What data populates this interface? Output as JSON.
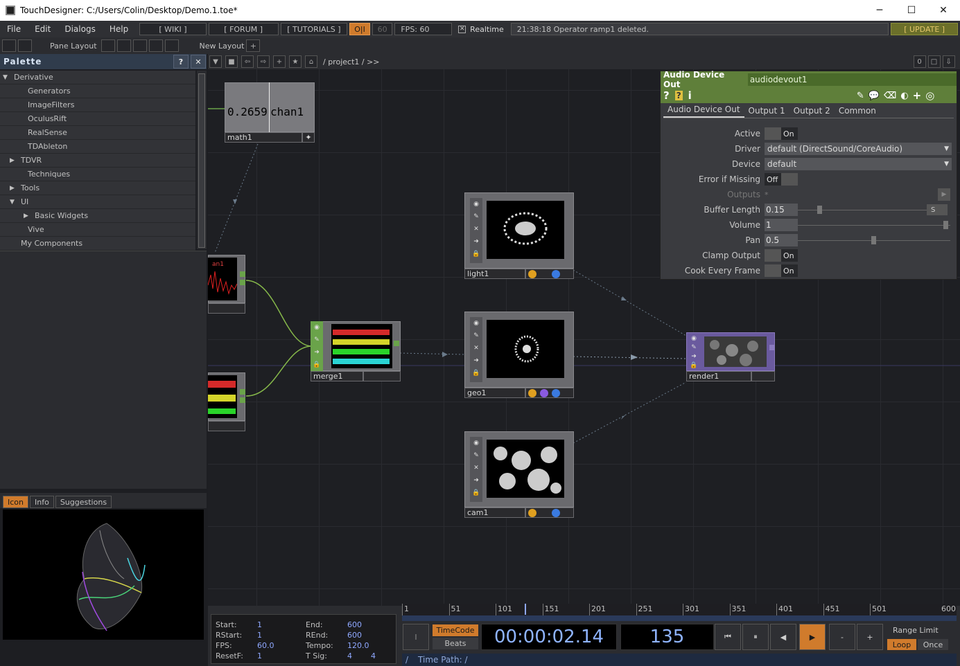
{
  "titlebar": {
    "title": "TouchDesigner: C:/Users/Colin/Desktop/Demo.1.toe*"
  },
  "menubar": {
    "menus": [
      "File",
      "Edit",
      "Dialogs",
      "Help"
    ],
    "buttons": {
      "wiki": "[ WIKI ]",
      "forum": "[ FORUM ]",
      "tutorials": "[ TUTORIALS ]",
      "oi": "O|I",
      "fps_cap": "60",
      "fps": "FPS:  60",
      "realtime": "Realtime"
    },
    "status": "21:38:18 Operator ramp1 deleted.",
    "update": "[ UPDATE ]"
  },
  "toolbar2": {
    "pane_layout": "Pane Layout",
    "new_layout": "New Layout",
    "plus": "+"
  },
  "palette": {
    "title": "Palette",
    "help": "?",
    "close": "✕",
    "items": [
      {
        "label": "Derivative",
        "indent": 0,
        "arrow": "▼"
      },
      {
        "label": "Generators",
        "indent": 2,
        "arrow": ""
      },
      {
        "label": "ImageFilters",
        "indent": 2,
        "arrow": ""
      },
      {
        "label": "OculusRift",
        "indent": 2,
        "arrow": ""
      },
      {
        "label": "RealSense",
        "indent": 2,
        "arrow": ""
      },
      {
        "label": "TDAbleton",
        "indent": 2,
        "arrow": ""
      },
      {
        "label": "TDVR",
        "indent": 1,
        "arrow": "▶"
      },
      {
        "label": "Techniques",
        "indent": 2,
        "arrow": ""
      },
      {
        "label": "Tools",
        "indent": 1,
        "arrow": "▶"
      },
      {
        "label": "UI",
        "indent": 1,
        "arrow": "▼"
      },
      {
        "label": "Basic Widgets",
        "indent": 3,
        "arrow": "▶"
      },
      {
        "label": "Vive",
        "indent": 2,
        "arrow": ""
      },
      {
        "label": "My Components",
        "indent": 1,
        "arrow": ""
      }
    ],
    "tabs": [
      "Icon",
      "Info",
      "Suggestions"
    ]
  },
  "network": {
    "path": "/ project1 / >>",
    "zero": "0",
    "nodes": {
      "math1": {
        "label": "math1",
        "value": "0.2659",
        "chan": "chan1"
      },
      "light1": {
        "label": "light1"
      },
      "geo1": {
        "label": "geo1"
      },
      "cam1": {
        "label": "cam1"
      },
      "merge1": {
        "label": "merge1"
      },
      "render1": {
        "label": "render1"
      },
      "partial": {
        "text": "an1"
      }
    }
  },
  "params": {
    "type": "Audio Device Out",
    "name": "audiodevout1",
    "tabs": [
      "Audio Device Out",
      "Output 1",
      "Output 2",
      "Common"
    ],
    "active": {
      "label": "Active",
      "value": "On"
    },
    "driver": {
      "label": "Driver",
      "value": "default (DirectSound/CoreAudio)"
    },
    "device": {
      "label": "Device",
      "value": "default"
    },
    "error_if_missing": {
      "label": "Error if Missing",
      "value": "Off"
    },
    "outputs": {
      "label": "Outputs",
      "value": "*"
    },
    "buffer_length": {
      "label": "Buffer Length",
      "value": "0.15",
      "unit": "S"
    },
    "volume": {
      "label": "Volume",
      "value": "1"
    },
    "pan": {
      "label": "Pan",
      "value": "0.5"
    },
    "clamp_output": {
      "label": "Clamp Output",
      "value": "On"
    },
    "cook_every_frame": {
      "label": "Cook Every Frame",
      "value": "On"
    }
  },
  "timeline": {
    "start_lbl": "Start:",
    "start": "1",
    "end_lbl": "End:",
    "end": "600",
    "rstart_lbl": "RStart:",
    "rstart": "1",
    "rend_lbl": "REnd:",
    "rend": "600",
    "fps_lbl": "FPS:",
    "fps": "60.0",
    "tempo_lbl": "Tempo:",
    "tempo": "120.0",
    "resetf_lbl": "ResetF:",
    "resetf": "1",
    "tsig_lbl": "T Sig:",
    "tsig_a": "4",
    "tsig_b": "4",
    "ticks": [
      "1",
      "51",
      "101",
      "151",
      "201",
      "251",
      "301",
      "351",
      "401",
      "451",
      "501",
      "600"
    ],
    "timecode_btn": "TimeCode",
    "beats_btn": "Beats",
    "timecode": "00:00:02.14",
    "frame": "135",
    "range_limit": "Range Limit",
    "loop": "Loop",
    "once": "Once",
    "time_path": "Time Path: /",
    "slash": "/",
    "i_btn": "I",
    "minus": "-",
    "plus": "+"
  },
  "colors": {
    "accent_orange": "#d07b2c",
    "param_green": "#5f7f3a",
    "render_purple": "#6a5a9e",
    "merge_green": "#6aa34a"
  }
}
